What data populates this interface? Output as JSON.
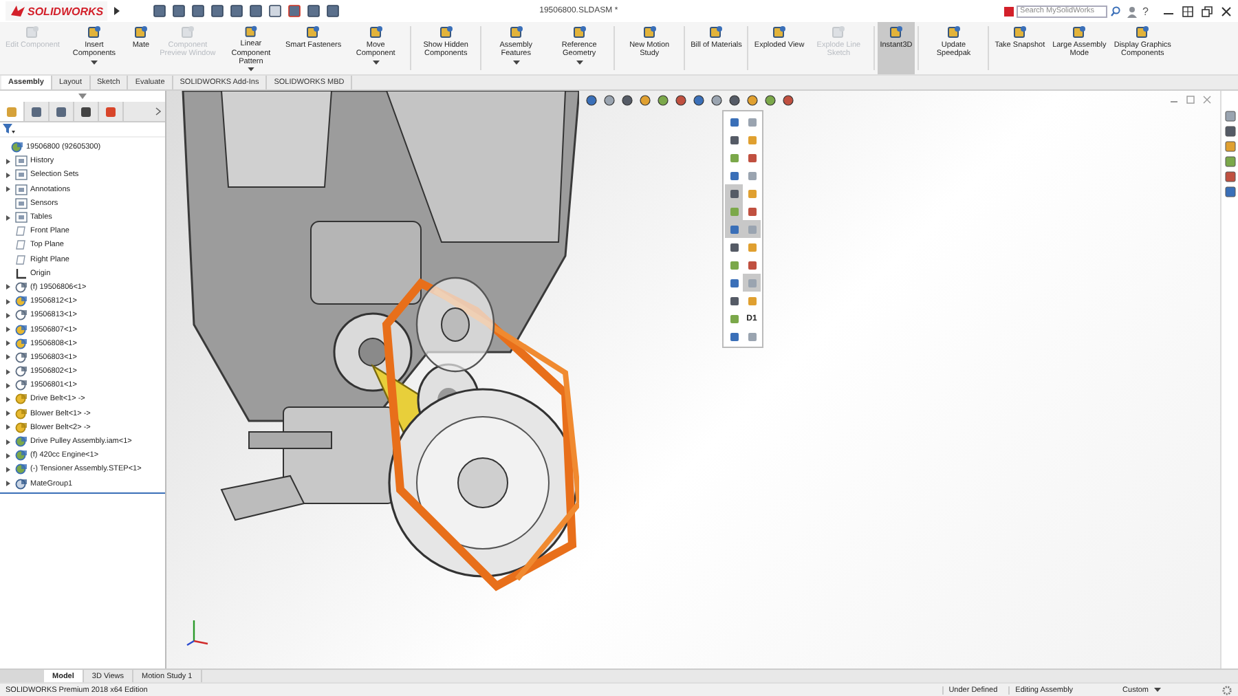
{
  "window": {
    "title": "19506800.SLDASM *",
    "logo": "SOLIDWORKS",
    "help": "?"
  },
  "search": {
    "placeholder": "Search MySolidWorks"
  },
  "ribbon": {
    "groups": [
      [
        {
          "label": "Edit Component",
          "disabled": true,
          "dropdown": false,
          "selected": false
        },
        {
          "label": "Insert Components",
          "disabled": false,
          "dropdown": true,
          "selected": false
        },
        {
          "label": "Mate",
          "disabled": false,
          "dropdown": false,
          "selected": false
        },
        {
          "label": "Component Preview Window",
          "disabled": true,
          "dropdown": false,
          "selected": false
        },
        {
          "label": "Linear Component Pattern",
          "disabled": false,
          "dropdown": true,
          "selected": false
        },
        {
          "label": "Smart Fasteners",
          "disabled": false,
          "dropdown": false,
          "selected": false
        },
        {
          "label": "Move Component",
          "disabled": false,
          "dropdown": true,
          "selected": false
        }
      ],
      [
        {
          "label": "Show Hidden Components",
          "disabled": false,
          "dropdown": false,
          "selected": false
        }
      ],
      [
        {
          "label": "Assembly Features",
          "disabled": false,
          "dropdown": true,
          "selected": false
        },
        {
          "label": "Reference Geometry",
          "disabled": false,
          "dropdown": true,
          "selected": false
        }
      ],
      [
        {
          "label": "New Motion Study",
          "disabled": false,
          "dropdown": false,
          "selected": false
        }
      ],
      [
        {
          "label": "Bill of Materials",
          "disabled": false,
          "dropdown": false,
          "selected": false
        }
      ],
      [
        {
          "label": "Exploded View",
          "disabled": false,
          "dropdown": false,
          "selected": false
        },
        {
          "label": "Explode Line Sketch",
          "disabled": true,
          "dropdown": false,
          "selected": false
        }
      ],
      [
        {
          "label": "Instant3D",
          "disabled": false,
          "dropdown": false,
          "selected": true
        }
      ],
      [
        {
          "label": "Update Speedpak",
          "disabled": false,
          "dropdown": false,
          "selected": false
        }
      ],
      [
        {
          "label": "Take Snapshot",
          "disabled": false,
          "dropdown": false,
          "selected": false
        },
        {
          "label": "Large Assembly Mode",
          "disabled": false,
          "dropdown": false,
          "selected": false
        },
        {
          "label": "Display Graphics Components",
          "disabled": false,
          "dropdown": false,
          "selected": false
        }
      ]
    ]
  },
  "command_tabs": [
    {
      "label": "Assembly",
      "selected": true
    },
    {
      "label": "Layout",
      "selected": false
    },
    {
      "label": "Sketch",
      "selected": false
    },
    {
      "label": "Evaluate",
      "selected": false
    },
    {
      "label": "SOLIDWORKS Add-Ins",
      "selected": false
    },
    {
      "label": "SOLIDWORKS MBD",
      "selected": false
    }
  ],
  "manager_tabs": [
    {
      "kind": "tree",
      "selected": true
    },
    {
      "kind": "property",
      "selected": false
    },
    {
      "kind": "config",
      "selected": false
    },
    {
      "kind": "dimxpert",
      "selected": false
    },
    {
      "kind": "display",
      "selected": false
    }
  ],
  "feature_tree": {
    "root": {
      "label": "19506800  (92605300)",
      "kind": "assembly",
      "expandable": false,
      "children": [
        {
          "label": "History",
          "kind": "folder",
          "expandable": true
        },
        {
          "label": "Selection Sets",
          "kind": "folder",
          "expandable": true
        },
        {
          "label": "Annotations",
          "kind": "folder",
          "expandable": true
        },
        {
          "label": "Sensors",
          "kind": "folder",
          "expandable": false
        },
        {
          "label": "Tables",
          "kind": "folder",
          "expandable": true
        },
        {
          "label": "Front Plane",
          "kind": "plane",
          "expandable": false
        },
        {
          "label": "Top Plane",
          "kind": "plane",
          "expandable": false
        },
        {
          "label": "Right Plane",
          "kind": "plane",
          "expandable": false
        },
        {
          "label": "Origin",
          "kind": "origin",
          "expandable": false
        },
        {
          "label": "(f) 19506806<1>",
          "kind": "part",
          "expandable": true
        },
        {
          "label": "19506812<1>",
          "kind": "part-color",
          "expandable": true
        },
        {
          "label": "19506813<1>",
          "kind": "part",
          "expandable": true
        },
        {
          "label": "19506807<1>",
          "kind": "part-color",
          "expandable": true
        },
        {
          "label": "19506808<1>",
          "kind": "part-color",
          "expandable": true
        },
        {
          "label": "19506803<1>",
          "kind": "part",
          "expandable": true
        },
        {
          "label": "19506802<1>",
          "kind": "part",
          "expandable": true
        },
        {
          "label": "19506801<1>",
          "kind": "part",
          "expandable": true
        },
        {
          "label": "Drive Belt<1> ->",
          "kind": "part-yellow",
          "expandable": true
        },
        {
          "label": "Blower Belt<1> ->",
          "kind": "part-yellow",
          "expandable": true
        },
        {
          "label": "Blower Belt<2> ->",
          "kind": "part-yellow",
          "expandable": true
        },
        {
          "label": "Drive Pulley Assembly.iam<1>",
          "kind": "assembly",
          "expandable": true
        },
        {
          "label": "(f) 420cc Engine<1>",
          "kind": "assembly",
          "expandable": true
        },
        {
          "label": "(-) Tensioner Assembly.STEP<1>",
          "kind": "assembly",
          "expandable": true
        },
        {
          "label": "MateGroup1",
          "kind": "mates",
          "expandable": true
        }
      ]
    }
  },
  "visibility_menu": {
    "items": [
      {
        "kind": "icon",
        "selected": false
      },
      {
        "kind": "icon",
        "selected": false
      },
      {
        "kind": "icon",
        "selected": false
      },
      {
        "kind": "icon",
        "selected": false
      },
      {
        "kind": "icon",
        "selected": false
      },
      {
        "kind": "icon",
        "selected": false
      },
      {
        "kind": "icon",
        "selected": false
      },
      {
        "kind": "icon",
        "selected": false
      },
      {
        "kind": "icon",
        "selected": true
      },
      {
        "kind": "icon",
        "selected": false
      },
      {
        "kind": "icon",
        "selected": true
      },
      {
        "kind": "icon",
        "selected": false
      },
      {
        "kind": "icon",
        "selected": true
      },
      {
        "kind": "icon",
        "selected": true
      },
      {
        "kind": "icon",
        "selected": false
      },
      {
        "kind": "icon",
        "selected": false
      },
      {
        "kind": "icon",
        "selected": false
      },
      {
        "kind": "icon",
        "selected": false
      },
      {
        "kind": "icon",
        "selected": false
      },
      {
        "kind": "icon",
        "selected": true
      },
      {
        "kind": "icon",
        "selected": false
      },
      {
        "kind": "icon",
        "selected": false
      },
      {
        "kind": "icon",
        "selected": false
      },
      {
        "kind": "text",
        "text": "D1",
        "selected": false
      },
      {
        "kind": "icon",
        "selected": false
      },
      {
        "kind": "icon",
        "selected": false
      }
    ]
  },
  "bottom_tabs": [
    {
      "label": "Model",
      "selected": true
    },
    {
      "label": "3D Views",
      "selected": false
    },
    {
      "label": "Motion Study 1",
      "selected": false
    }
  ],
  "status_bar": {
    "edition": "SOLIDWORKS Premium 2018 x64 Edition",
    "state": "Under Defined",
    "mode": "Editing Assembly",
    "units": "Custom"
  }
}
